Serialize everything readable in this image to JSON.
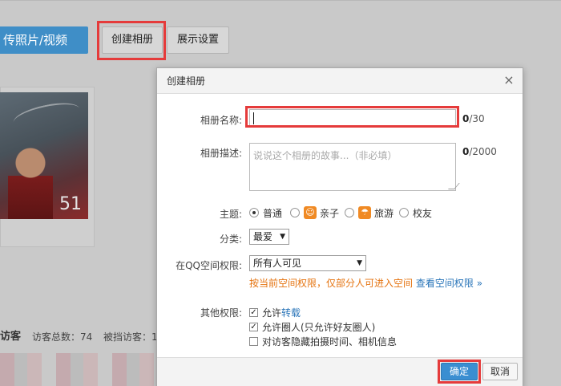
{
  "toolbar": {
    "upload_label": "传照片/视频",
    "create_label": "创建相册",
    "display_label": "展示设置"
  },
  "album": {
    "count": "51"
  },
  "visitors": {
    "title": "访客",
    "total_text": "访客总数：74",
    "blocked_text": "被挡访客：1"
  },
  "dialog": {
    "title": "创建相册",
    "close_glyph": "×",
    "name_label": "相册名称:",
    "name_value": "",
    "name_count": "0",
    "name_max": "/30",
    "desc_label": "相册描述:",
    "desc_placeholder": "说说这个相册的故事...（非必填）",
    "desc_count": "0",
    "desc_max": "/2000",
    "theme_label": "主题:",
    "themes": [
      {
        "label": "普通",
        "selected": true,
        "icon": ""
      },
      {
        "label": "亲子",
        "selected": false,
        "icon": "baby-face-icon"
      },
      {
        "label": "旅游",
        "selected": false,
        "icon": "umbrella-icon"
      },
      {
        "label": "校友",
        "selected": false,
        "icon": ""
      }
    ],
    "category_label": "分类:",
    "category_value": "最爱",
    "permission_label": "在QQ空间权限:",
    "permission_value": "所有人可见",
    "permission_note": "按当前空间权限，仅部分人可进入空间",
    "permission_link": "查看空间权限",
    "permission_link_chev": "»",
    "other_label": "其他权限:",
    "options": [
      {
        "prefix": "允许",
        "link": "转载",
        "suffix": "",
        "checked": true
      },
      {
        "prefix": "允许圈人(只允许好友圈人)",
        "link": "",
        "suffix": "",
        "checked": true
      },
      {
        "prefix": "对访客隐藏拍摄时间、相机信息",
        "link": "",
        "suffix": "",
        "checked": false
      }
    ],
    "ok_label": "确定",
    "cancel_label": "取消"
  },
  "colors": {
    "accent": "#3a8ed1",
    "highlight": "#e53b3b",
    "warning_text": "#e57411",
    "link": "#2a75b9"
  }
}
